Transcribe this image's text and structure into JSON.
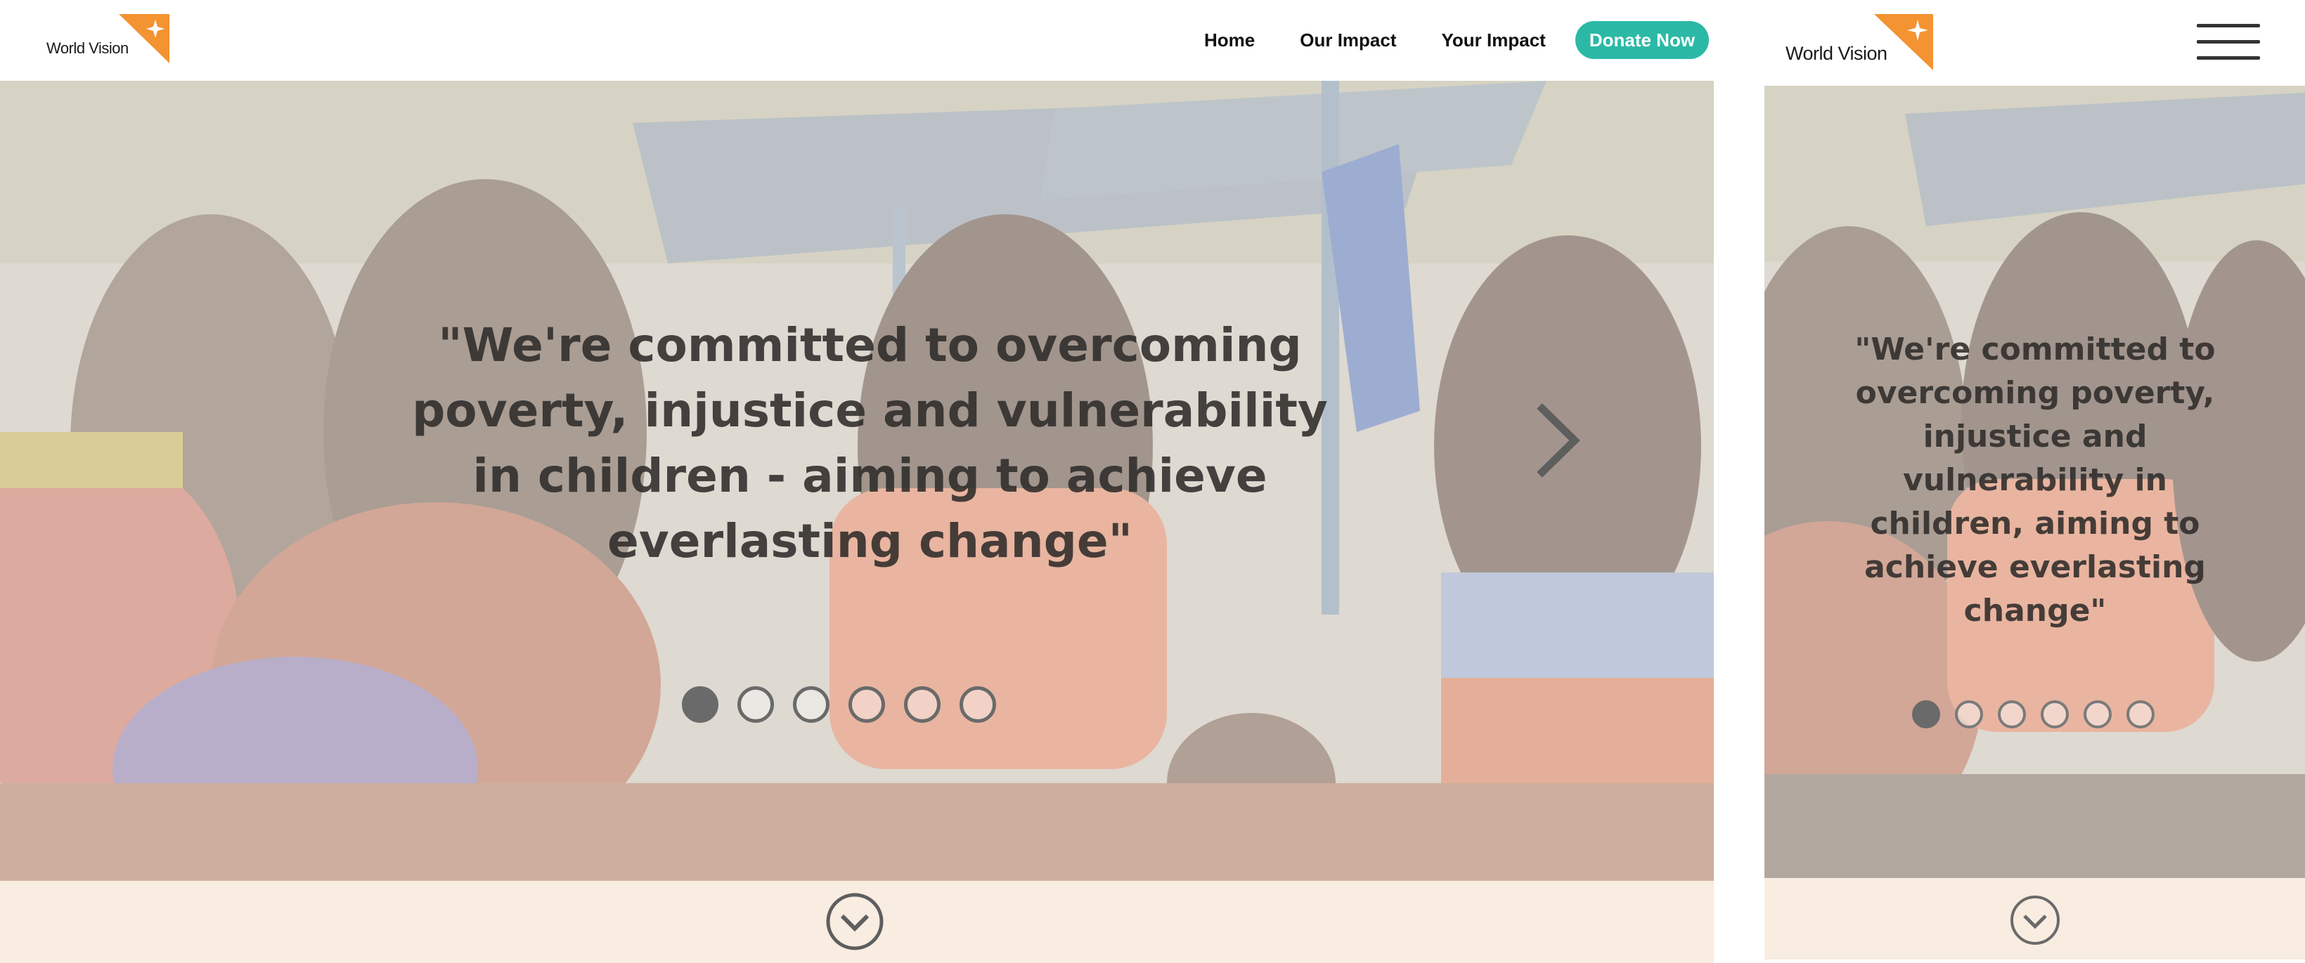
{
  "brand": {
    "name": "World Vision",
    "accent_color": "#f39332",
    "teal_color": "#2bb9a6",
    "footer_color": "#f9ece1"
  },
  "nav": {
    "items": [
      {
        "label": "Home"
      },
      {
        "label": "Our Impact"
      },
      {
        "label": "Your Impact"
      }
    ],
    "cta_label": "Donate Now"
  },
  "hero": {
    "quote_desktop": "\"We're committed to overcoming poverty, injustice and vulnerability in children - aiming to achieve everlasting change\"",
    "quote_mobile": "\"We're committed to overcoming poverty, injustice and vulnerability in children, aiming to achieve everlasting change\"",
    "slide_count": 6,
    "active_slide": 1,
    "next_icon": "chevron-right-icon"
  },
  "footer": {
    "scroll_icon": "chevron-down-circle-icon"
  },
  "mobile": {
    "menu_icon": "hamburger-menu-icon"
  }
}
